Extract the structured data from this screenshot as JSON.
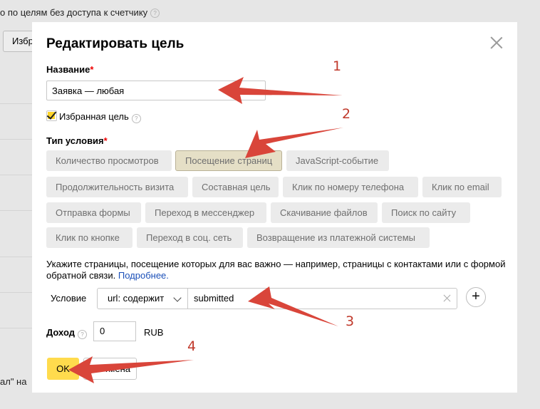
{
  "background": {
    "top_text": "о по целям без доступа к счетчику",
    "button": "Избр",
    "bottom_text": "ал\" на"
  },
  "modal": {
    "title": "Редактировать цель",
    "name_label": "Название",
    "name_value": "Заявка — любая",
    "favorite_label": "Избранная цель",
    "favorite_checked": true,
    "condition_type_label": "Тип условия",
    "condition_types": [
      {
        "label": "Количество просмотров",
        "selected": false
      },
      {
        "label": "Посещение страниц",
        "selected": true
      },
      {
        "label": "JavaScript-событие",
        "selected": false
      },
      {
        "label": "Продолжительность визита",
        "selected": false
      },
      {
        "label": "Составная цель",
        "selected": false
      },
      {
        "label": "Клик по номеру телефона",
        "selected": false
      },
      {
        "label": "Клик по email",
        "selected": false
      },
      {
        "label": "Отправка формы",
        "selected": false
      },
      {
        "label": "Переход в мессенджер",
        "selected": false
      },
      {
        "label": "Скачивание файлов",
        "selected": false
      },
      {
        "label": "Поиск по сайту",
        "selected": false
      },
      {
        "label": "Клик по кнопке",
        "selected": false
      },
      {
        "label": "Переход в соц. сеть",
        "selected": false
      },
      {
        "label": "Возвращение из платежной системы",
        "selected": false
      }
    ],
    "hint_text": "Укажите страницы, посещение которых для вас важно — например, страницы с контактами или с формой обратной связи.",
    "hint_link": "Подробнее.",
    "condition_label": "Условие",
    "condition_operator": "url: содержит",
    "condition_value": "submitted",
    "income_label": "Доход",
    "income_value": "0",
    "currency": "RUB",
    "ok_label": "OK",
    "cancel_label": "Отмена"
  },
  "annotations": {
    "numbers": [
      "1",
      "2",
      "3",
      "4"
    ],
    "arrow_color": "#d9453a"
  }
}
